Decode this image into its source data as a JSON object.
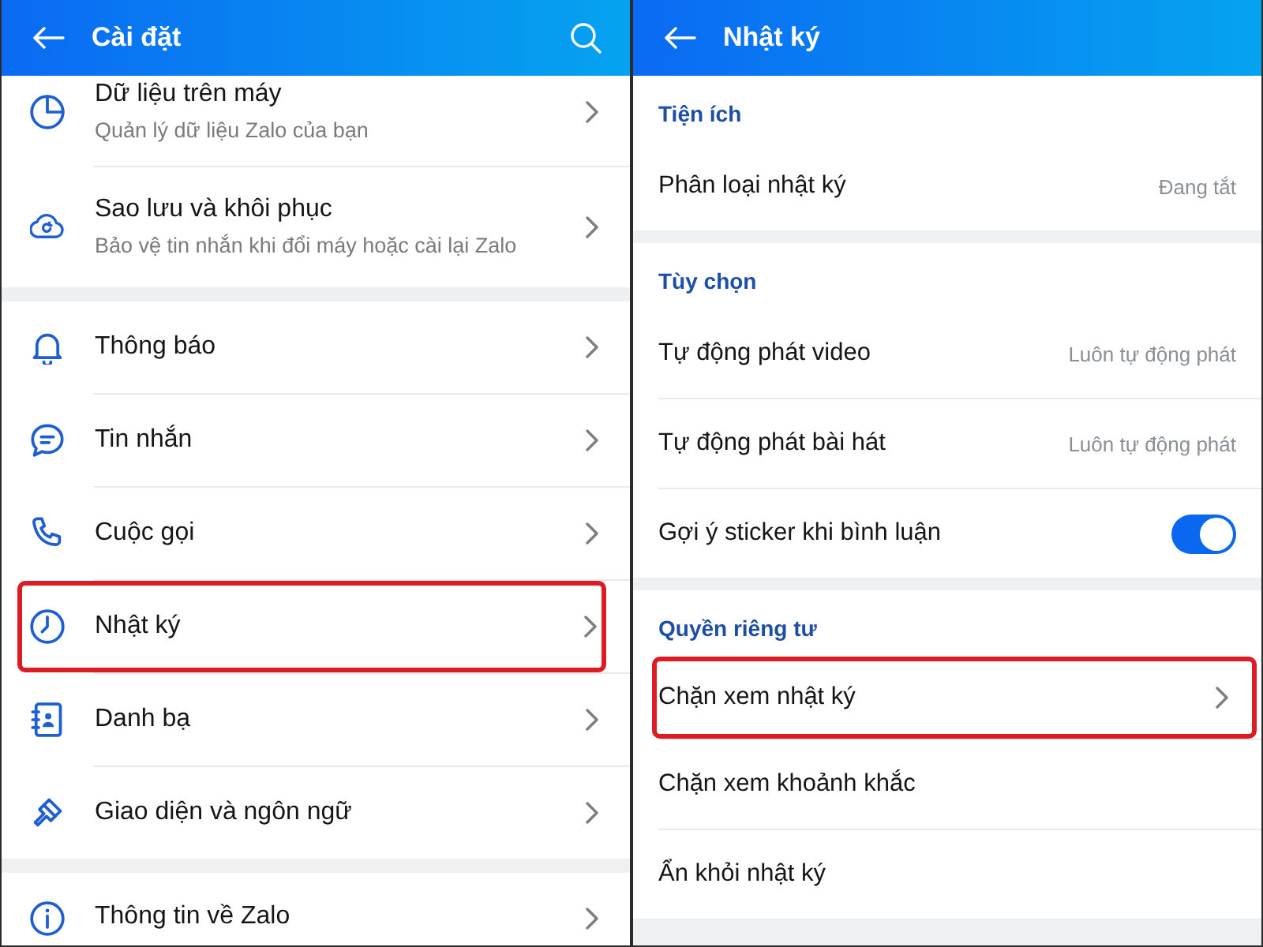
{
  "left_screen": {
    "title": "Cài đặt",
    "groups": [
      {
        "items": [
          {
            "title": "Dữ liệu trên máy",
            "subtitle": "Quản lý dữ liệu Zalo của bạn",
            "highlighted": false
          },
          {
            "title": "Sao lưu và khôi phục",
            "subtitle": "Bảo vệ tin nhắn khi đổi máy hoặc cài lại Zalo",
            "highlighted": false
          }
        ]
      },
      {
        "items": [
          {
            "title": "Thông báo",
            "highlighted": false
          },
          {
            "title": "Tin nhắn",
            "highlighted": false
          },
          {
            "title": "Cuộc gọi",
            "highlighted": false
          },
          {
            "title": "Nhật ký",
            "highlighted": true
          },
          {
            "title": "Danh bạ",
            "highlighted": false
          },
          {
            "title": "Giao diện và ngôn ngữ",
            "highlighted": false
          }
        ]
      },
      {
        "items": [
          {
            "title": "Thông tin về Zalo",
            "highlighted": false
          }
        ]
      }
    ]
  },
  "right_screen": {
    "title": "Nhật ký",
    "sections": [
      {
        "header": "Tiện ích",
        "items": [
          {
            "kind": "value",
            "label": "Phân loại nhật ký",
            "value": "Đang tắt",
            "highlighted": false
          }
        ]
      },
      {
        "header": "Tùy chọn",
        "items": [
          {
            "kind": "value",
            "label": "Tự động phát video",
            "value": "Luôn tự động phát",
            "highlighted": false
          },
          {
            "kind": "value",
            "label": "Tự động phát bài hát",
            "value": "Luôn tự động phát",
            "highlighted": false
          },
          {
            "kind": "toggle",
            "label": "Gợi ý sticker khi bình luận",
            "on": true,
            "highlighted": false
          }
        ]
      },
      {
        "header": "Quyền riêng tư",
        "items": [
          {
            "kind": "link",
            "label": "Chặn xem nhật ký",
            "highlighted": true
          },
          {
            "kind": "plain",
            "label": "Chặn xem khoảnh khắc",
            "highlighted": false
          },
          {
            "kind": "plain",
            "label": "Ẩn khỏi nhật ký",
            "highlighted": false
          }
        ]
      }
    ]
  }
}
